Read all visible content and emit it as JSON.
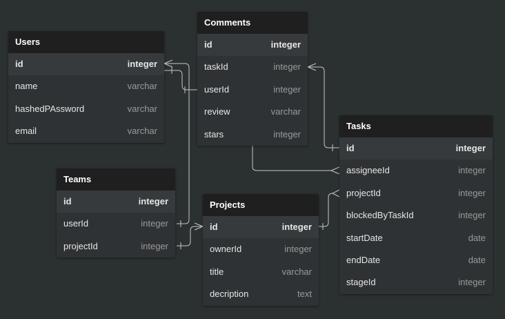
{
  "diagram": {
    "tables": [
      {
        "id": "users",
        "name": "Users",
        "fields": [
          {
            "name": "id",
            "type": "integer",
            "pk": true
          },
          {
            "name": "name",
            "type": "varchar"
          },
          {
            "name": "hashedPAssword",
            "type": "varchar"
          },
          {
            "name": "email",
            "type": "varchar"
          }
        ]
      },
      {
        "id": "comments",
        "name": "Comments",
        "fields": [
          {
            "name": "id",
            "type": "integer",
            "pk": true
          },
          {
            "name": "taskId",
            "type": "integer"
          },
          {
            "name": "userId",
            "type": "integer"
          },
          {
            "name": "review",
            "type": "varchar"
          },
          {
            "name": "stars",
            "type": "integer"
          }
        ]
      },
      {
        "id": "teams",
        "name": "Teams",
        "fields": [
          {
            "name": "id",
            "type": "integer",
            "pk": true
          },
          {
            "name": "userId",
            "type": "integer"
          },
          {
            "name": "projectId",
            "type": "integer"
          }
        ]
      },
      {
        "id": "projects",
        "name": "Projects",
        "fields": [
          {
            "name": "id",
            "type": "integer",
            "pk": true
          },
          {
            "name": "ownerId",
            "type": "integer"
          },
          {
            "name": "title",
            "type": "varchar"
          },
          {
            "name": "decription",
            "type": "text"
          }
        ]
      },
      {
        "id": "tasks",
        "name": "Tasks",
        "fields": [
          {
            "name": "id",
            "type": "integer",
            "pk": true
          },
          {
            "name": "assigneeId",
            "type": "integer"
          },
          {
            "name": "projectId",
            "type": "integer"
          },
          {
            "name": "blockedByTaskId",
            "type": "integer"
          },
          {
            "name": "startDate",
            "type": "date"
          },
          {
            "name": "endDate",
            "type": "date"
          },
          {
            "name": "stageId",
            "type": "integer"
          }
        ]
      }
    ],
    "relationships": [
      {
        "from": "users.id",
        "to": "comments.userId"
      },
      {
        "from": "users.id",
        "to": "teams.userId"
      },
      {
        "from": "tasks.id",
        "to": "comments.taskId"
      },
      {
        "from": "projects.id",
        "to": "teams.projectId"
      },
      {
        "from": "projects.id",
        "to": "tasks.projectId"
      },
      {
        "from": "comments",
        "to": "tasks.assigneeId"
      }
    ],
    "colors": {
      "background": "#2b3031",
      "table_header": "#1f1f20",
      "table_body": "#2f3234",
      "connector": "#c8c8c8"
    }
  }
}
